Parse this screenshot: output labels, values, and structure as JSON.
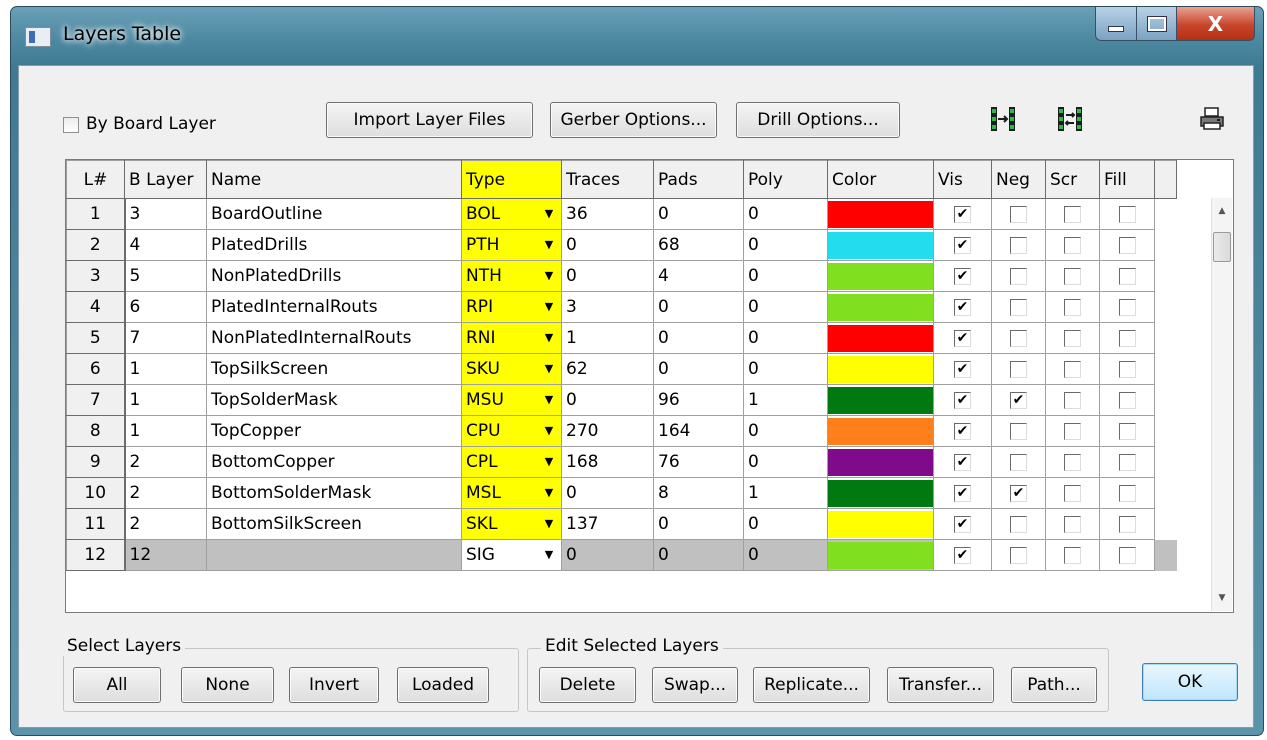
{
  "window": {
    "title": "Layers Table",
    "close_glyph": "X"
  },
  "toolbar": {
    "by_board_layer": "By Board Layer",
    "by_board_layer_checked": false,
    "import_layer_files": "Import Layer Files",
    "gerber_options": "Gerber Options...",
    "drill_options": "Drill Options...",
    "icons": [
      "align-columns-icon",
      "swap-columns-icon",
      "printer-icon"
    ]
  },
  "grid": {
    "headers": {
      "lnum": "L#",
      "blayer": "B Layer",
      "name": "Name",
      "type": "Type",
      "traces": "Traces",
      "pads": "Pads",
      "poly": "Poly",
      "color": "Color",
      "vis": "Vis",
      "neg": "Neg",
      "scr": "Scr",
      "fill": "Fill"
    },
    "rows": [
      {
        "lnum": "1",
        "blayer": "3",
        "name": "BoardOutline",
        "type": "BOL",
        "traces": "36",
        "pads": "0",
        "poly": "0",
        "color": "#ff0000",
        "vis": true,
        "neg": false,
        "scr": false,
        "fill": false
      },
      {
        "lnum": "2",
        "blayer": "4",
        "name": "PlatedDrills",
        "type": "PTH",
        "traces": "0",
        "pads": "68",
        "poly": "0",
        "color": "#22ddee",
        "vis": true,
        "neg": false,
        "scr": false,
        "fill": false
      },
      {
        "lnum": "3",
        "blayer": "5",
        "name": "NonPlatedDrills",
        "type": "NTH",
        "traces": "0",
        "pads": "4",
        "poly": "0",
        "color": "#80e020",
        "vis": true,
        "neg": false,
        "scr": false,
        "fill": false
      },
      {
        "lnum": "4",
        "blayer": "6",
        "name": "PlatedInternalRouts",
        "type": "RPI",
        "traces": "3",
        "pads": "0",
        "poly": "0",
        "color": "#80e020",
        "vis": true,
        "neg": false,
        "scr": false,
        "fill": false
      },
      {
        "lnum": "5",
        "blayer": "7",
        "name": "NonPlatedInternalRouts",
        "type": "RNI",
        "traces": "1",
        "pads": "0",
        "poly": "0",
        "color": "#ff0000",
        "vis": true,
        "neg": false,
        "scr": false,
        "fill": false
      },
      {
        "lnum": "6",
        "blayer": "1",
        "name": "TopSilkScreen",
        "type": "SKU",
        "traces": "62",
        "pads": "0",
        "poly": "0",
        "color": "#ffff00",
        "vis": true,
        "neg": false,
        "scr": false,
        "fill": false
      },
      {
        "lnum": "7",
        "blayer": "1",
        "name": "TopSolderMask",
        "type": "MSU",
        "traces": "0",
        "pads": "96",
        "poly": "1",
        "color": "#007a10",
        "vis": true,
        "neg": true,
        "scr": false,
        "fill": false
      },
      {
        "lnum": "8",
        "blayer": "1",
        "name": "TopCopper",
        "type": "CPU",
        "traces": "270",
        "pads": "164",
        "poly": "0",
        "color": "#ff7f1a",
        "vis": true,
        "neg": false,
        "scr": false,
        "fill": false
      },
      {
        "lnum": "9",
        "blayer": "2",
        "name": "BottomCopper",
        "type": "CPL",
        "traces": "168",
        "pads": "76",
        "poly": "0",
        "color": "#7f0a8a",
        "vis": true,
        "neg": false,
        "scr": false,
        "fill": false
      },
      {
        "lnum": "10",
        "blayer": "2",
        "name": "BottomSolderMask",
        "type": "MSL",
        "traces": "0",
        "pads": "8",
        "poly": "1",
        "color": "#007a10",
        "vis": true,
        "neg": true,
        "scr": false,
        "fill": false
      },
      {
        "lnum": "11",
        "blayer": "2",
        "name": "BottomSilkScreen",
        "type": "SKL",
        "traces": "137",
        "pads": "0",
        "poly": "0",
        "color": "#ffff00",
        "vis": true,
        "neg": false,
        "scr": false,
        "fill": false
      },
      {
        "lnum": "12",
        "blayer": "12",
        "name": "",
        "type": "SIG",
        "traces": "0",
        "pads": "0",
        "poly": "0",
        "color": "#80e020",
        "vis": true,
        "neg": false,
        "scr": false,
        "fill": false,
        "selected": true
      }
    ]
  },
  "select_layers": {
    "label": "Select Layers",
    "all": "All",
    "none": "None",
    "invert": "Invert",
    "loaded": "Loaded"
  },
  "edit_selected": {
    "label": "Edit Selected Layers",
    "delete": "Delete",
    "swap": "Swap...",
    "replicate": "Replicate...",
    "transfer": "Transfer...",
    "path": "Path..."
  },
  "ok": "OK"
}
